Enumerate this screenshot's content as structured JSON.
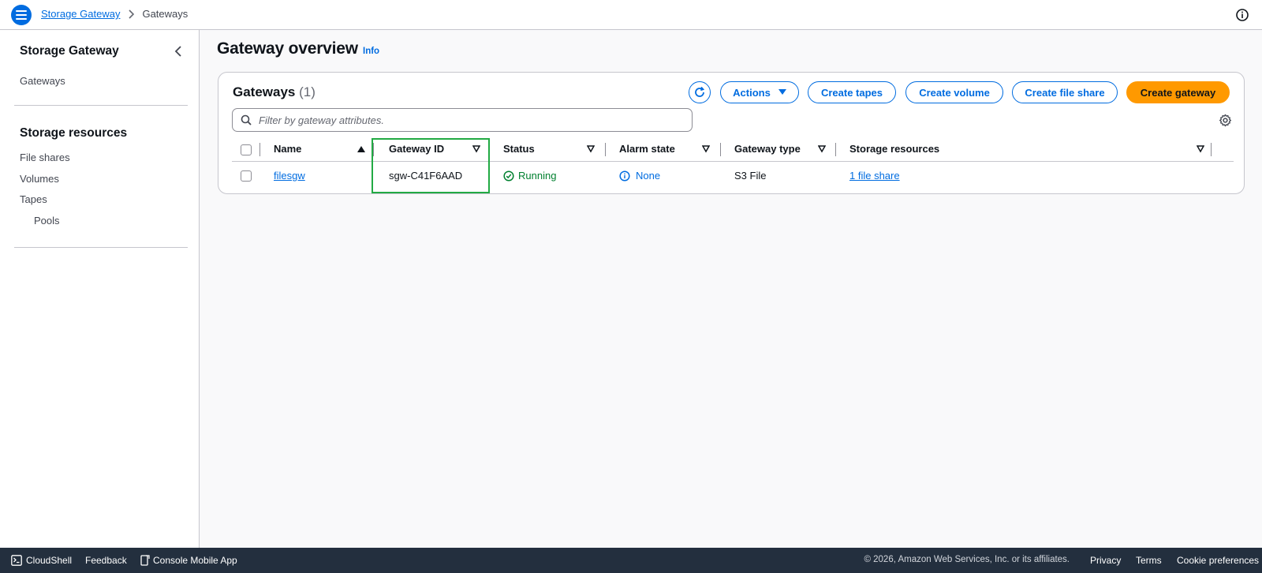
{
  "breadcrumb": {
    "parent": "Storage Gateway",
    "current": "Gateways"
  },
  "sidebar": {
    "title": "Storage Gateway",
    "gateways": "Gateways",
    "section_title": "Storage resources",
    "items": [
      "File shares",
      "Volumes",
      "Tapes"
    ],
    "sub_item": "Pools"
  },
  "main": {
    "page_title": "Gateway overview",
    "info": "Info"
  },
  "card": {
    "title": "Gateways",
    "count": "(1)",
    "buttons": {
      "actions": "Actions",
      "create_tapes": "Create tapes",
      "create_volume": "Create volume",
      "create_file_share": "Create file share",
      "create_gateway": "Create gateway"
    },
    "filter_placeholder": "Filter by gateway attributes."
  },
  "table": {
    "columns": [
      "Name",
      "Gateway ID",
      "Status",
      "Alarm state",
      "Gateway type",
      "Storage resources"
    ],
    "rows": [
      {
        "name": "filesgw",
        "gateway_id": "sgw-C41F6AAD",
        "status": "Running",
        "alarm_state": "None",
        "gateway_type": "S3 File",
        "storage_resources": "1 file share"
      }
    ]
  },
  "footer": {
    "cloudshell": "CloudShell",
    "feedback": "Feedback",
    "mobile_app": "Console Mobile App",
    "copyright": "© 2026, Amazon Web Services, Inc. or its affiliates.",
    "privacy": "Privacy",
    "terms": "Terms",
    "cookies": "Cookie preferences"
  },
  "colors": {
    "accent": "#006ce0",
    "primary_button": "#ff9900",
    "success": "#00802f",
    "highlight": "#22aa44",
    "footer_bg": "#232f3e"
  }
}
